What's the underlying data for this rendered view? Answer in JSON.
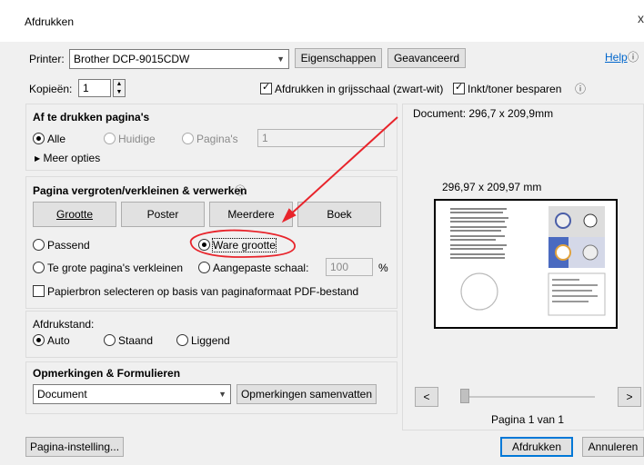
{
  "window": {
    "title": "Afdrukken",
    "close": "x"
  },
  "printer": {
    "label": "Printer:",
    "value": "Brother DCP-9015CDW",
    "properties": "Eigenschappen",
    "advanced": "Geavanceerd",
    "help": "Help"
  },
  "copies": {
    "label": "Kopieën:",
    "value": "1",
    "grayscale": "Afdrukken in grijsschaal (zwart-wit)",
    "save_ink": "Inkt/toner besparen"
  },
  "pages": {
    "title": "Af te drukken pagina's",
    "all": "Alle",
    "current": "Huidige",
    "pages": "Pagina's",
    "pages_value": "1",
    "more": "Meer opties"
  },
  "sizing": {
    "title": "Pagina vergroten/verkleinen & verwerken",
    "size": "Grootte",
    "poster": "Poster",
    "multiple": "Meerdere",
    "booklet": "Boek",
    "fit": "Passend",
    "actual": "Ware grootte",
    "shrink": "Te grote pagina's verkleinen",
    "custom": "Aangepaste schaal:",
    "custom_value": "100",
    "percent": "%",
    "paper_source": "Papierbron selecteren op basis van paginaformaat PDF-bestand"
  },
  "orientation": {
    "title": "Afdrukstand:",
    "auto": "Auto",
    "portrait": "Staand",
    "landscape": "Liggend"
  },
  "comments": {
    "title": "Opmerkingen & Formulieren",
    "value": "Document",
    "summarize": "Opmerkingen samenvatten"
  },
  "preview": {
    "doc_size": "Document: 296,7 x 209,9mm",
    "paper_size": "296,97 x 209,97 mm",
    "page_label": "Pagina 1 van 1",
    "prev": "<",
    "next": ">"
  },
  "footer": {
    "page_setup": "Pagina-instelling...",
    "print": "Afdrukken",
    "cancel": "Annuleren"
  },
  "colors": {
    "annotation": "#e8242b",
    "accent": "#0078d7"
  }
}
